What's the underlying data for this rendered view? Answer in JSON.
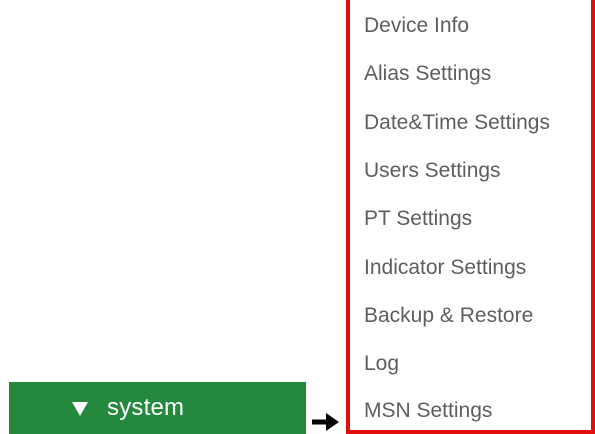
{
  "system_button": {
    "label": "system",
    "expanded": true,
    "color": "#24893d"
  },
  "arrow": {
    "icon": "right-arrow"
  },
  "highlight": {
    "color": "#e00d0d"
  },
  "menu": {
    "items": [
      {
        "label": "Device Info"
      },
      {
        "label": "Alias Settings"
      },
      {
        "label": "Date&Time Settings"
      },
      {
        "label": "Users Settings"
      },
      {
        "label": "PT Settings"
      },
      {
        "label": "Indicator Settings"
      },
      {
        "label": "Backup & Restore"
      },
      {
        "label": "Log"
      },
      {
        "label": "MSN Settings"
      }
    ]
  }
}
